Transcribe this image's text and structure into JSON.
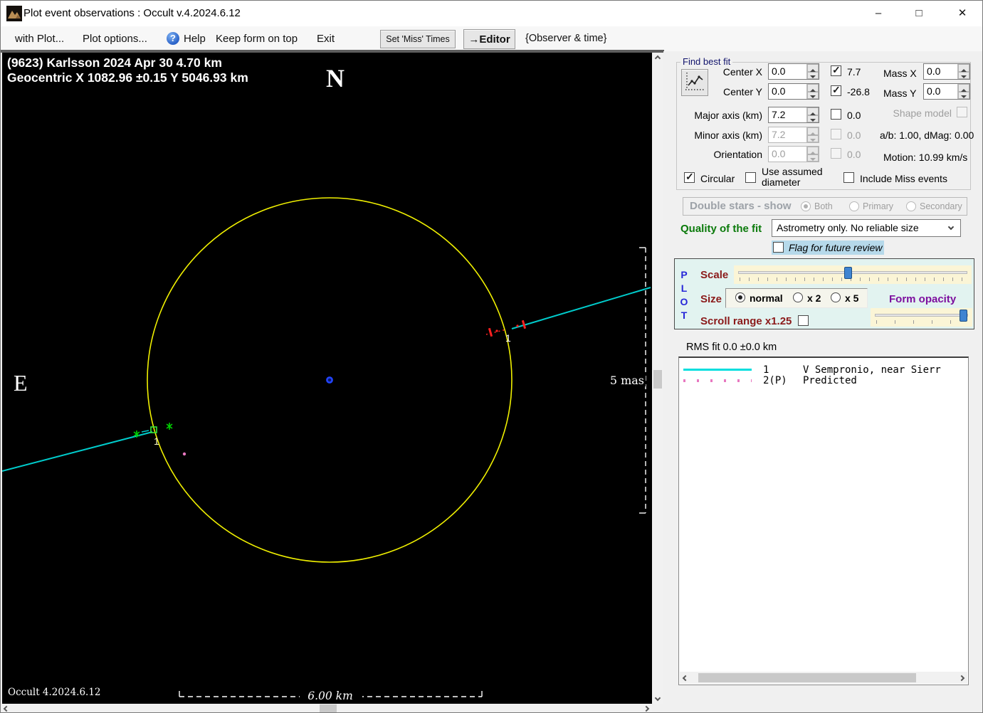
{
  "window": {
    "title": "Plot event observations : Occult v.4.2024.6.12",
    "controls": {
      "minimize": "–",
      "maximize": "□",
      "close": "✕"
    }
  },
  "menubar": {
    "with_plot": "with Plot...",
    "plot_options": "Plot options...",
    "help": "Help",
    "help_icon_glyph": "?",
    "keep_on_top": "Keep form on top",
    "exit": "Exit",
    "set_miss_times": "Set 'Miss' Times",
    "editor": "→Editor",
    "observer_time": "{Observer & time}"
  },
  "plot": {
    "header_line1": "(9623) Karlsson  2024 Apr 30   4.70 km",
    "header_line2": "Geocentric  X  1082.96 ±0.15  Y 5046.93 km",
    "north": "N",
    "east": "E",
    "vertical_scale": "5 mas",
    "horizontal_scale": "6.00 km",
    "version": "Occult 4.2024.6.12",
    "chord_left_label": "1",
    "chord_right_label": "1",
    "colors": {
      "asteroid_outline": "#f0f000",
      "observed_chord": "#00cccc",
      "disappearance_markers": "#ff2020",
      "reappearance_markers": "#00d000",
      "predicted_point": "#e878c0",
      "center_point": "#2244ff"
    }
  },
  "fit_panel": {
    "group_title": "Find best fit",
    "center_x_label": "Center X",
    "center_x_value": "0.0",
    "center_y_label": "Center Y",
    "center_y_value": "0.0",
    "major_axis_label": "Major axis (km)",
    "major_axis_value": "7.2",
    "minor_axis_label": "Minor axis (km)",
    "minor_axis_value": "7.2",
    "orientation_label": "Orientation",
    "orientation_value": "0.0",
    "check_row1_value": "7.7",
    "check_row2_value": "-26.8",
    "check_row3_value": "0.0",
    "check_row4_value": "0.0",
    "check_row5_value": "0.0",
    "mass_x_label": "Mass X",
    "mass_x_value": "0.0",
    "mass_y_label": "Mass Y",
    "mass_y_value": "0.0",
    "shape_model_label": "Shape model",
    "ab_dmag_label": "a/b: 1.00, dMag: 0.00",
    "motion_label": "Motion: 10.99 km/s",
    "circular_label": "Circular",
    "use_assumed_label": "Use assumed diameter",
    "include_miss_label": "Include Miss events"
  },
  "double_stars": {
    "title": "Double stars - show",
    "options": [
      "Both",
      "Primary",
      "Secondary"
    ]
  },
  "quality": {
    "label": "Quality of the fit",
    "value": "Astrometry only. No reliable size",
    "flag_label": "Flag for future review"
  },
  "plot_controls": {
    "vertical_letters": [
      "P",
      "L",
      "O",
      "T"
    ],
    "scale_label": "Scale",
    "size_label": "Size",
    "size_options": [
      "normal",
      "x 2",
      "x 5"
    ],
    "form_opacity_label": "Form opacity",
    "scroll_range_label": "Scroll range x1.25"
  },
  "rms": {
    "label": "RMS fit 0.0 ±0.0 km"
  },
  "legend": {
    "entries": [
      {
        "id": "1",
        "name": "V Sempronio, near Sierr",
        "style": "solid-cyan",
        "color": "#00dede"
      },
      {
        "id": "2(P)",
        "name": "Predicted",
        "style": "dotted-pink",
        "color": "#e878c0"
      }
    ]
  }
}
